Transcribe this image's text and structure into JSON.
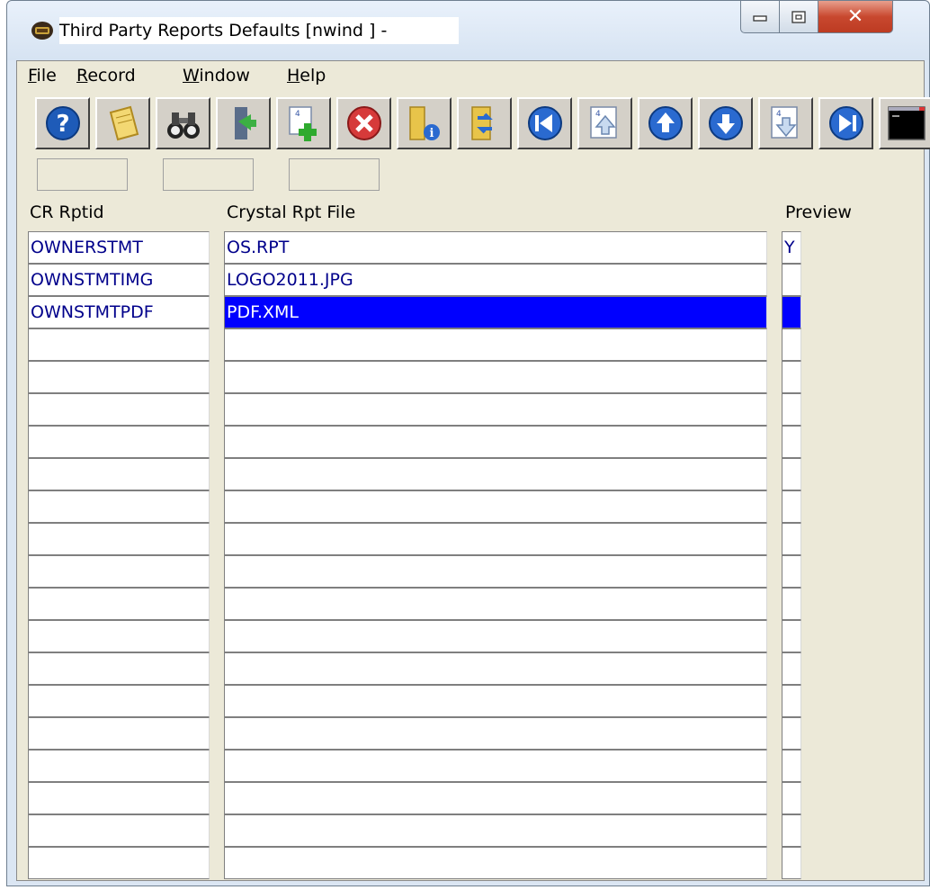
{
  "window": {
    "title": "Third Party Reports Defaults [nwind  ] -"
  },
  "menu": {
    "items": [
      "File",
      "Record",
      "Window",
      "Help"
    ],
    "mnemonics": [
      "F",
      "R",
      "W",
      "H"
    ]
  },
  "toolbar": {
    "buttons": [
      {
        "name": "help-button",
        "icon": "help-icon"
      },
      {
        "name": "notes-button",
        "icon": "notepad-icon"
      },
      {
        "name": "find-button",
        "icon": "binoculars-icon"
      },
      {
        "name": "exit-button",
        "icon": "exit-door-icon"
      },
      {
        "name": "add-record-button",
        "icon": "add-record-icon"
      },
      {
        "name": "delete-record-button",
        "icon": "delete-icon"
      },
      {
        "name": "info-button",
        "icon": "folder-info-icon"
      },
      {
        "name": "refresh-button",
        "icon": "refresh-icon"
      },
      {
        "name": "first-record-button",
        "icon": "first-record-icon"
      },
      {
        "name": "page-up-button",
        "icon": "page-up-icon"
      },
      {
        "name": "previous-record-button",
        "icon": "arrow-up-icon"
      },
      {
        "name": "next-record-button",
        "icon": "arrow-down-icon"
      },
      {
        "name": "page-down-button",
        "icon": "page-down-icon"
      },
      {
        "name": "last-record-button",
        "icon": "last-record-icon"
      },
      {
        "name": "console-button",
        "icon": "console-icon"
      }
    ]
  },
  "grid": {
    "headers": {
      "rptid": "CR Rptid",
      "file": "Crystal Rpt File",
      "preview": "Preview"
    },
    "rows": [
      {
        "rptid": "OWNERSTMT",
        "file": "OS.RPT",
        "preview": "Y"
      },
      {
        "rptid": "OWNSTMTIMG",
        "file": "LOGO2011.JPG",
        "preview": ""
      },
      {
        "rptid": "OWNSTMTPDF",
        "file": "PDF.XML",
        "preview": ""
      }
    ],
    "selected_row": 2,
    "empty_rows": 17
  },
  "colors": {
    "selection": "#0000ff",
    "cell_text": "#00008b",
    "close_button": "#c8482f"
  }
}
